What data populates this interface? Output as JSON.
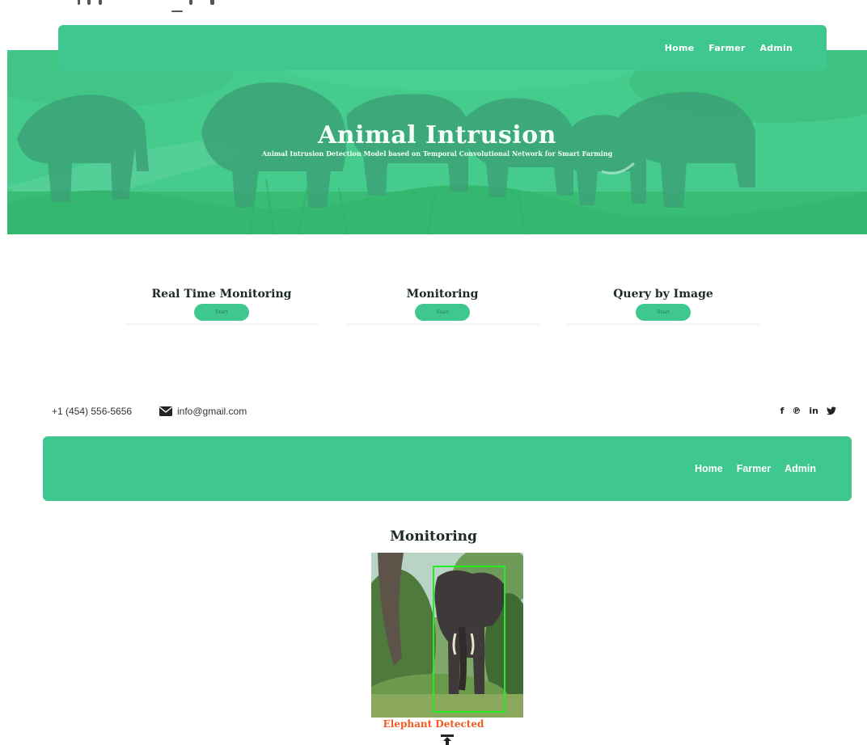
{
  "hero_nav": {
    "links": [
      "Home",
      "Farmer",
      "Admin"
    ]
  },
  "hero": {
    "title": "Animal Intrusion",
    "subtitle": "Animal Intrusion Detection Model based on Temporal Convolutional Network for Smart Farming"
  },
  "features": [
    {
      "title": "Real Time Monitoring",
      "button": "Start"
    },
    {
      "title": "Monitoring",
      "button": "Start"
    },
    {
      "title": "Query by Image",
      "button": "Start"
    }
  ],
  "contact": {
    "phone": "+1 (454) 556-5656",
    "email": "info@gmail.com",
    "socials": [
      "facebook-icon",
      "pinterest-icon",
      "linkedin-icon",
      "twitter-icon"
    ]
  },
  "main_nav": {
    "links": [
      "Home",
      "Farmer",
      "Admin"
    ]
  },
  "monitoring": {
    "title": "Monitoring",
    "result": "Elephant Detected",
    "image_desc_icon": "upload-icon"
  },
  "colors": {
    "accent": "#3ec78f",
    "detected": "#f05a20",
    "bbox": "#22ee22"
  }
}
